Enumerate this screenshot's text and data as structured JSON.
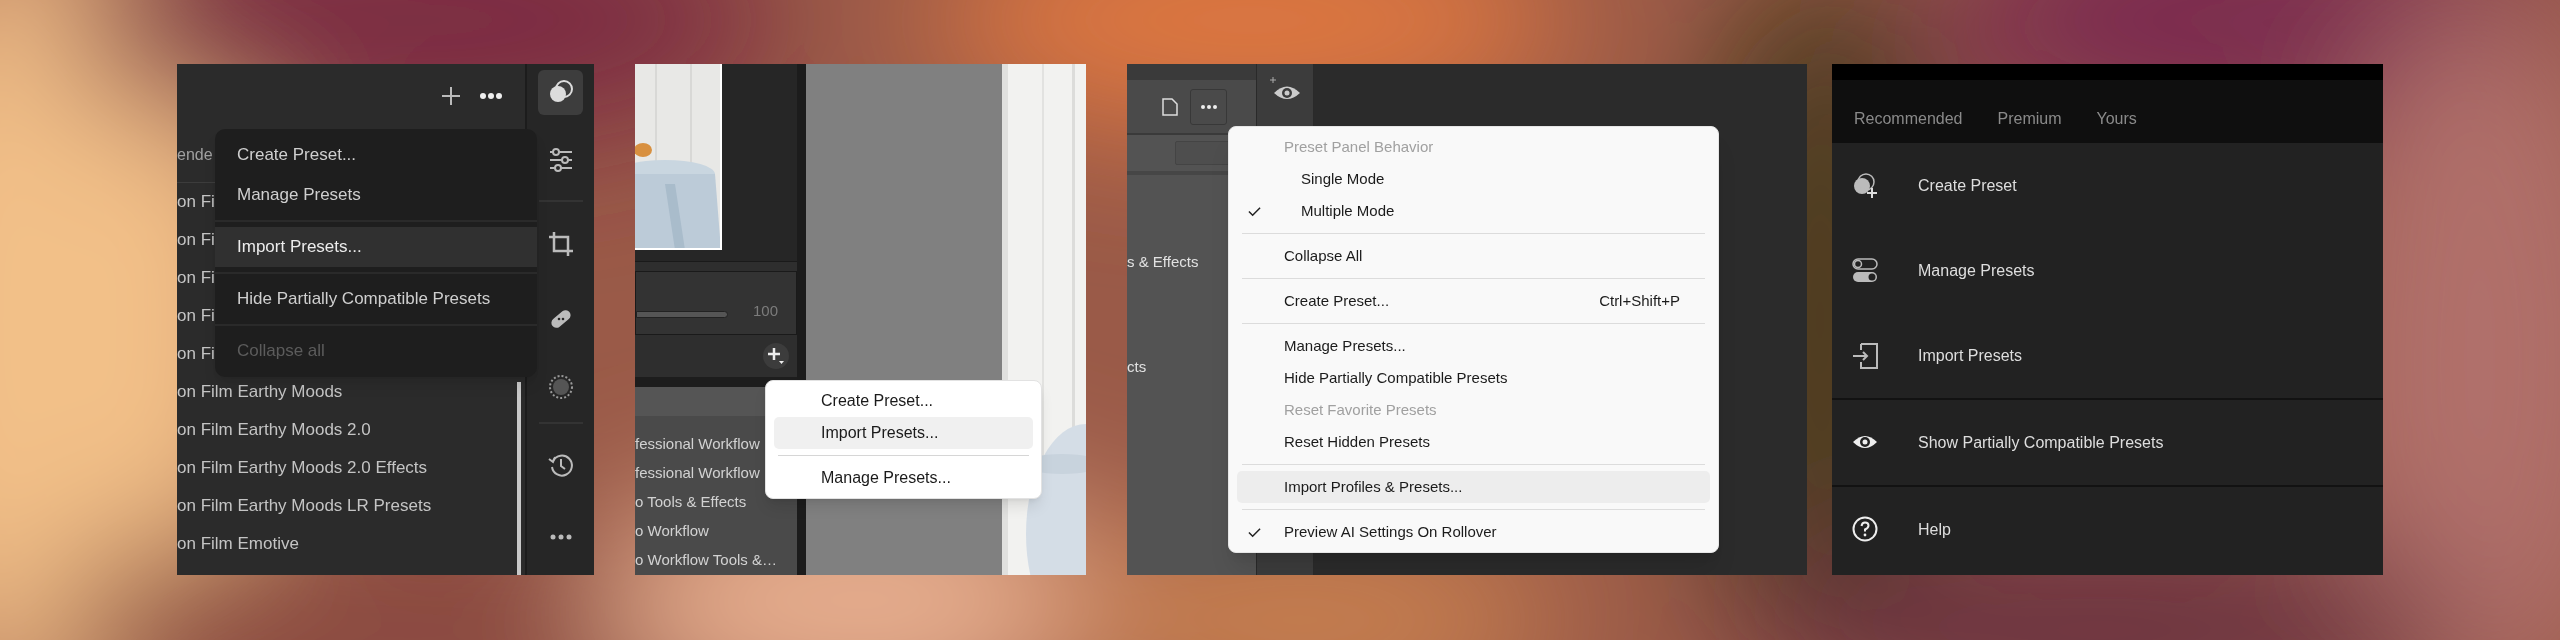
{
  "panels": [
    {
      "kind": "dark_popover",
      "tab_fragment": "ende",
      "preset_list": [
        "on Fi",
        "on Fi",
        "on Fi",
        "on Fi",
        "on Fi",
        "on Film Earthy Moods",
        "on Film Earthy Moods 2.0",
        "on Film Earthy Moods 2.0 Effects",
        "on Film Earthy Moods LR Presets",
        "on Film Emotive"
      ],
      "menu": [
        {
          "kind": "item",
          "label": "Create Preset...",
          "selected": false,
          "disabled": false
        },
        {
          "kind": "item",
          "label": "Manage Presets",
          "selected": false,
          "disabled": false
        },
        {
          "kind": "separator"
        },
        {
          "kind": "item",
          "label": "Import Presets...",
          "selected": true,
          "disabled": false
        },
        {
          "kind": "separator"
        },
        {
          "kind": "item",
          "label": "Hide Partially Compatible Presets",
          "selected": false,
          "disabled": false
        },
        {
          "kind": "separator"
        },
        {
          "kind": "item",
          "label": "Collapse all",
          "selected": false,
          "disabled": true
        }
      ],
      "toolbar": [
        {
          "selected": true
        },
        {
          "selected": false
        },
        {
          "selected": false
        },
        {
          "selected": false
        },
        {
          "selected": false
        },
        {
          "selected": false
        },
        {
          "selected": false
        }
      ]
    },
    {
      "kind": "light_popup",
      "slider_reading": "100",
      "preset_list": [
        "fessional Workflow",
        "fessional Workflow",
        "o Tools & Effects",
        "o Workflow",
        "o Workflow Tools &…"
      ],
      "menu": [
        {
          "kind": "item",
          "label": "Create Preset...",
          "selected": false
        },
        {
          "kind": "item",
          "label": "Import Presets...",
          "selected": true
        },
        {
          "kind": "separator"
        },
        {
          "kind": "item",
          "label": "Manage Presets...",
          "selected": false
        }
      ]
    },
    {
      "kind": "checked_menu",
      "preset_list": [
        "s & Effects",
        "cts"
      ],
      "menu": [
        {
          "kind": "header",
          "label": "Preset Panel Behavior",
          "children": [
            {
              "kind": "item",
              "label": "Single Mode",
              "checked": false,
              "disabled": false,
              "selected": false
            },
            {
              "kind": "item",
              "label": "Multiple Mode",
              "checked": true,
              "disabled": false,
              "selected": false
            }
          ]
        },
        {
          "kind": "separator"
        },
        {
          "kind": "item",
          "label": "Collapse All",
          "checked": false,
          "disabled": false,
          "selected": false
        },
        {
          "kind": "separator"
        },
        {
          "kind": "item",
          "label": "Create Preset...",
          "shortcut": "Ctrl+Shift+P",
          "checked": false,
          "disabled": false,
          "selected": false
        },
        {
          "kind": "separator"
        },
        {
          "kind": "item",
          "label": "Manage Presets...",
          "checked": false,
          "disabled": false,
          "selected": false
        },
        {
          "kind": "item",
          "label": "Hide Partially Compatible Presets",
          "checked": false,
          "disabled": false,
          "selected": false
        },
        {
          "kind": "item",
          "label": "Reset Favorite Presets",
          "checked": false,
          "disabled": true,
          "selected": false
        },
        {
          "kind": "item",
          "label": "Reset Hidden Presets",
          "checked": false,
          "disabled": false,
          "selected": false
        },
        {
          "kind": "separator"
        },
        {
          "kind": "item",
          "label": "Import Profiles & Presets...",
          "checked": false,
          "disabled": false,
          "selected": true
        },
        {
          "kind": "separator"
        },
        {
          "kind": "item",
          "label": "Preview AI Settings On Rollover",
          "checked": true,
          "disabled": false,
          "selected": false
        }
      ]
    },
    {
      "kind": "mobile_sheet",
      "tabs": [
        {
          "label": "Recommended",
          "selected": false
        },
        {
          "label": "Premium",
          "selected": false
        },
        {
          "label": "Yours",
          "selected": false
        }
      ],
      "groups": [
        {
          "items": [
            {
              "label": "Create Preset"
            },
            {
              "label": "Manage Presets"
            },
            {
              "label": "Import Presets"
            }
          ]
        },
        {
          "items": [
            {
              "label": "Show Partially Compatible Presets"
            }
          ]
        },
        {
          "items": [
            {
              "label": "Help"
            }
          ]
        }
      ]
    }
  ]
}
